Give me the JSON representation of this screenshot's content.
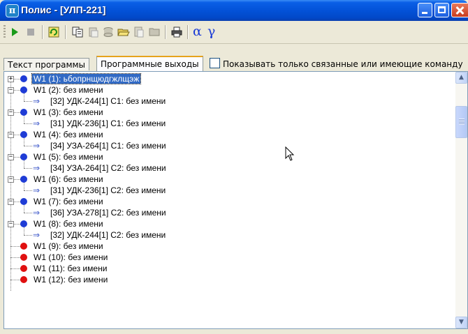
{
  "window": {
    "app_icon_glyph": "π",
    "title": "Полис - [УЛП-221]"
  },
  "toolbar": {
    "icons": [
      "play-icon",
      "stop-icon",
      "refresh-icon",
      "copy-icon",
      "paste-icon",
      "database-icon",
      "open-folder-icon",
      "paste-doc-icon",
      "folder-icon",
      "print-icon",
      "alpha-icon",
      "gamma-icon"
    ],
    "alpha": "α",
    "gamma": "γ"
  },
  "tabs": [
    {
      "label": "Текст программы"
    },
    {
      "label": "Программные выходы"
    }
  ],
  "filter_checkbox": {
    "label": "Показывать только связанные или имеющие команду",
    "checked": false
  },
  "tree": {
    "nodes": [
      {
        "label": "W1 (1): ьбопрнщюдгжлщэж",
        "color": "#1f3cd6",
        "expander": "+",
        "selected": true,
        "children": []
      },
      {
        "label": "W1 (2): без имени",
        "color": "#1f3cd6",
        "expander": "-",
        "children": [
          "[32] УДК-244[1] С1: без имени"
        ]
      },
      {
        "label": "W1 (3): без имени",
        "color": "#1f3cd6",
        "expander": "-",
        "children": [
          "[31] УДК-236[1] С1: без имени"
        ]
      },
      {
        "label": "W1 (4): без имени",
        "color": "#1f3cd6",
        "expander": "-",
        "children": [
          "[34] УЗА-264[1] С1: без имени"
        ]
      },
      {
        "label": "W1 (5): без имени",
        "color": "#1f3cd6",
        "expander": "-",
        "children": [
          "[34] УЗА-264[1] С2: без имени"
        ]
      },
      {
        "label": "W1 (6): без имени",
        "color": "#1f3cd6",
        "expander": "-",
        "children": [
          "[31] УДК-236[1] С2: без имени"
        ]
      },
      {
        "label": "W1 (7): без имени",
        "color": "#1f3cd6",
        "expander": "-",
        "children": [
          "[36] УЗА-278[1] С2: без имени"
        ]
      },
      {
        "label": "W1 (8): без имени",
        "color": "#1f3cd6",
        "expander": "-",
        "children": [
          "[32] УДК-244[1] С2: без имени"
        ]
      },
      {
        "label": "W1 (9): без имени",
        "color": "#e01010",
        "expander": "",
        "children": []
      },
      {
        "label": "W1 (10): без имени",
        "color": "#e01010",
        "expander": "",
        "children": []
      },
      {
        "label": "W1 (11): без имени",
        "color": "#e01010",
        "expander": "",
        "children": []
      },
      {
        "label": "W1 (12): без имени",
        "color": "#e01010",
        "expander": "",
        "children": []
      }
    ]
  },
  "scrollbar": {
    "up_glyph": "▲",
    "down_glyph": "▼"
  }
}
